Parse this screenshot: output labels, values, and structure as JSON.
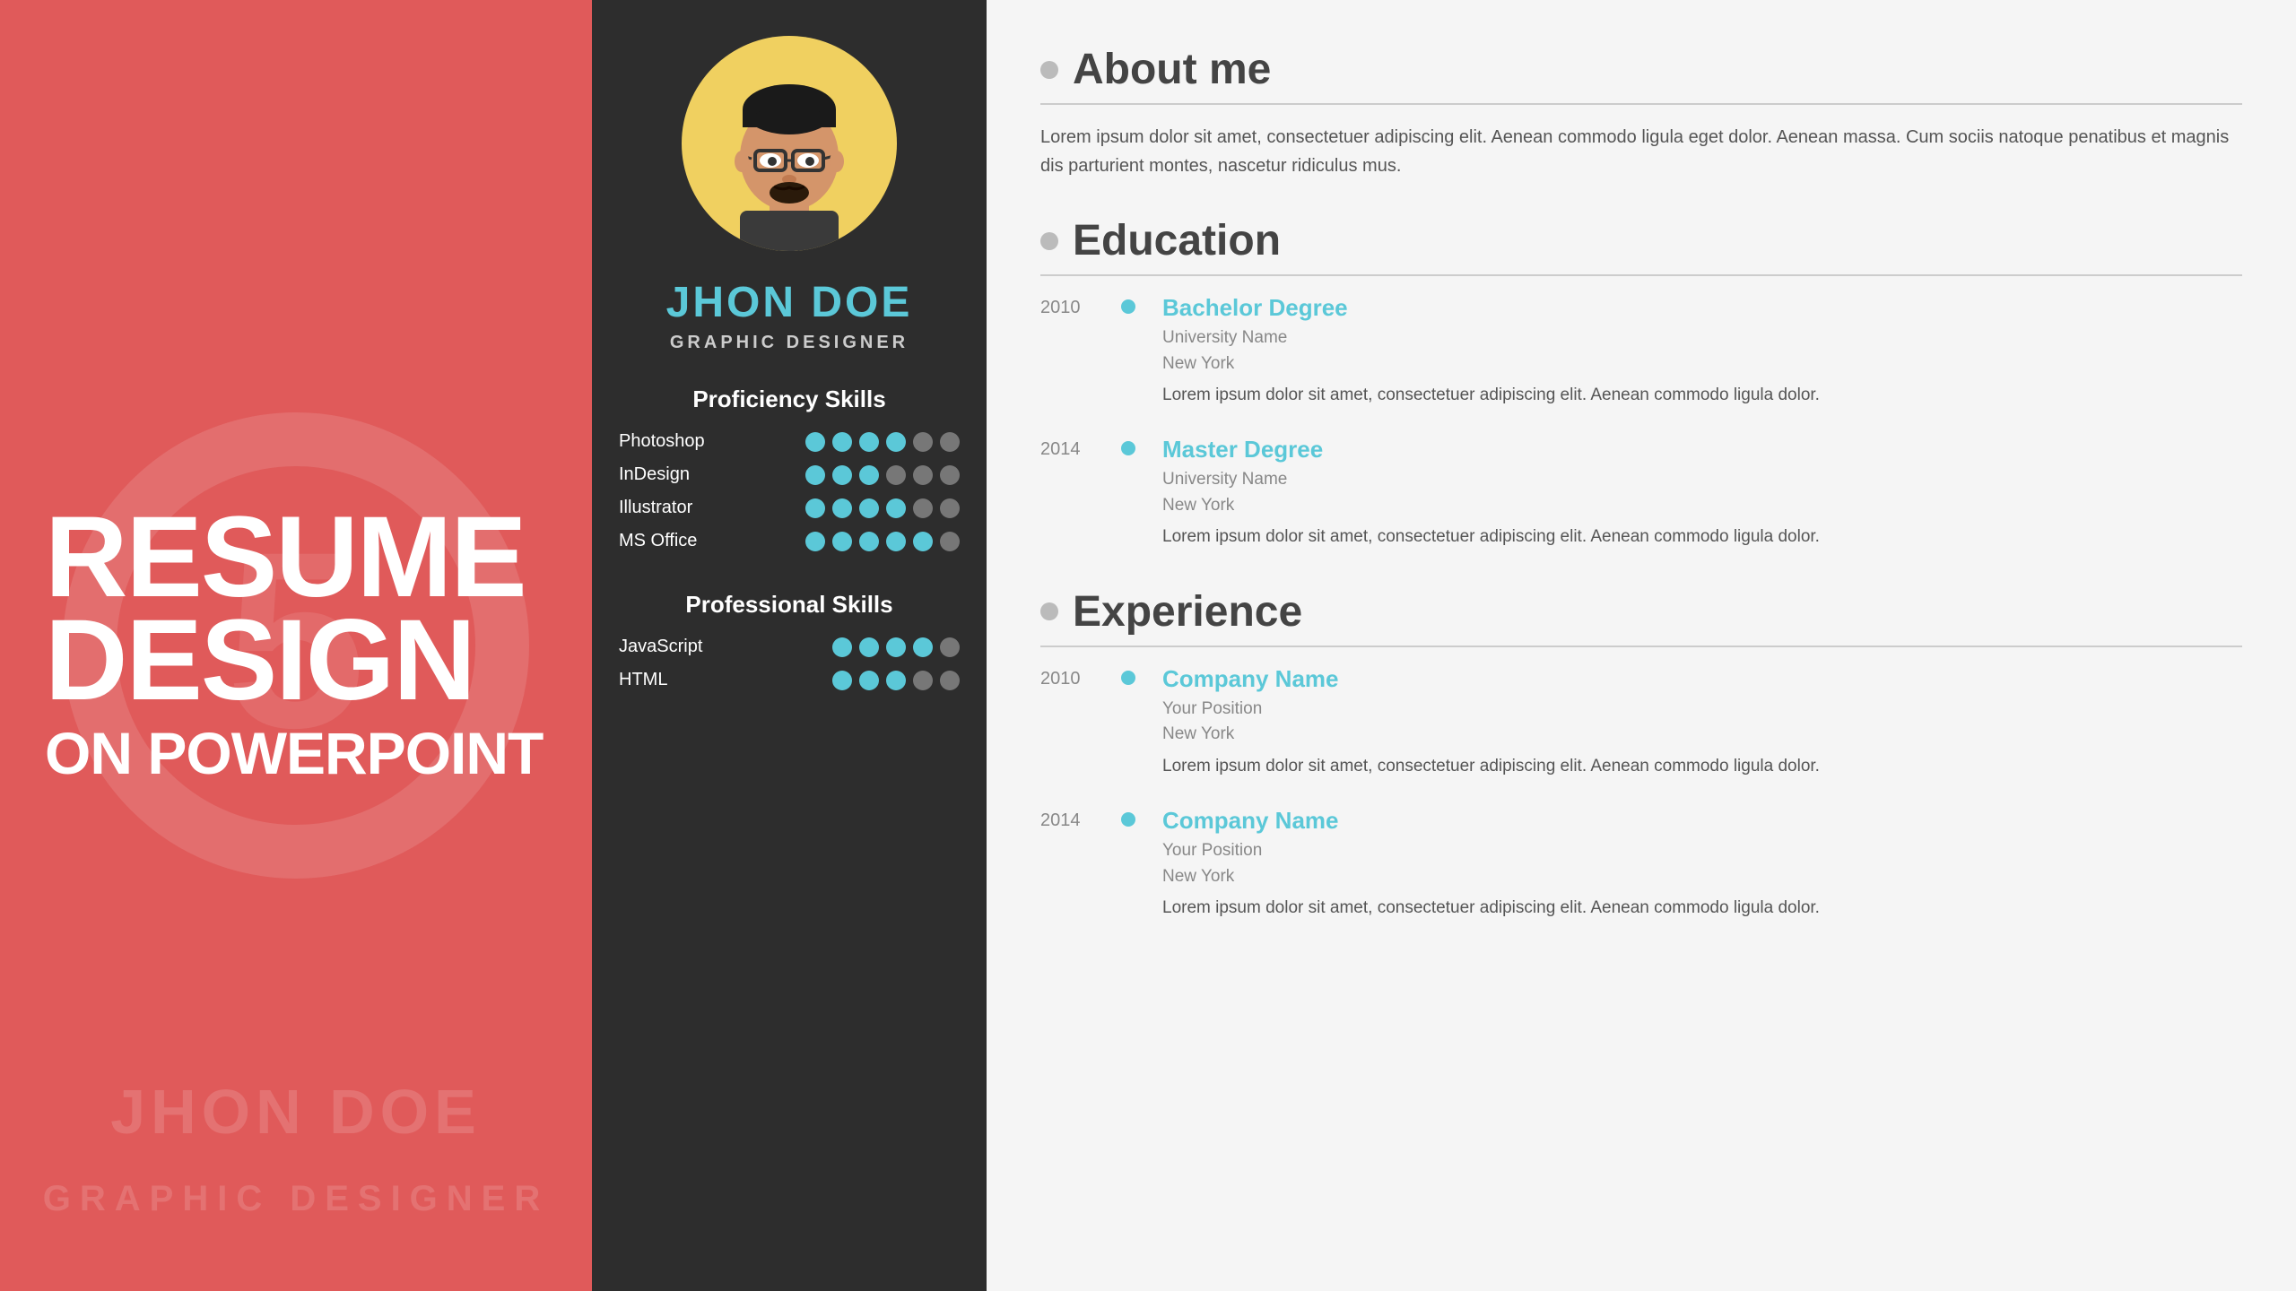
{
  "left": {
    "title_line1": "RESUME",
    "title_line2": "DESIGN",
    "title_line3": "",
    "title_line4": "ON POWERPOINT",
    "watermark_name": "JHON DOE",
    "watermark_subtitle": "GRAPHIC DESIGNER"
  },
  "middle": {
    "name": "JHON DOE",
    "title": "GRAPHIC DESIGNER",
    "proficiency_skills_label": "Proficiency Skills",
    "professional_skills_label": "Professional Skills",
    "skills": [
      {
        "name": "Photoshop",
        "filled": 4,
        "empty": 2
      },
      {
        "name": "InDesign",
        "filled": 3,
        "empty": 3
      },
      {
        "name": "Illustrator",
        "filled": 4,
        "empty": 2
      },
      {
        "name": "MS Office",
        "filled": 5,
        "empty": 1
      }
    ],
    "pro_skills": [
      {
        "name": "JavaScript",
        "filled": 4,
        "empty": 1
      },
      {
        "name": "HTML",
        "filled": 3,
        "empty": 2
      }
    ]
  },
  "right": {
    "about_me": {
      "section_title": "About me",
      "body": "Lorem ipsum dolor sit amet, consectetuer adipiscing elit. Aenean commodo ligula eget dolor. Aenean massa. Cum sociis natoque penatibus et magnis dis parturient montes, nascetur ridiculus mus."
    },
    "education": {
      "section_title": "Education",
      "items": [
        {
          "year": "2010",
          "degree": "Bachelor Degree",
          "school": "University Name",
          "location": "New York",
          "desc": "Lorem ipsum dolor sit amet, consectetuer adipiscing elit. Aenean commodo ligula dolor."
        },
        {
          "year": "2014",
          "degree": "Master Degree",
          "school": "University Name",
          "location": "New York",
          "desc": "Lorem ipsum dolor sit amet, consectetuer adipiscing elit. Aenean commodo ligula dolor."
        }
      ]
    },
    "experience": {
      "section_title": "Experience",
      "items": [
        {
          "year": "2010",
          "company": "Company Name",
          "position": "Your Position",
          "location": "New York",
          "desc": "Lorem ipsum dolor sit amet, consectetuer adipiscing elit. Aenean commodo ligula dolor."
        },
        {
          "year": "2014",
          "company": "Company Name",
          "position": "Your Position",
          "location": "New York",
          "desc": "Lorem ipsum dolor sit amet, consectetuer adipiscing elit. Aenean commodo ligula dolor."
        }
      ]
    }
  }
}
